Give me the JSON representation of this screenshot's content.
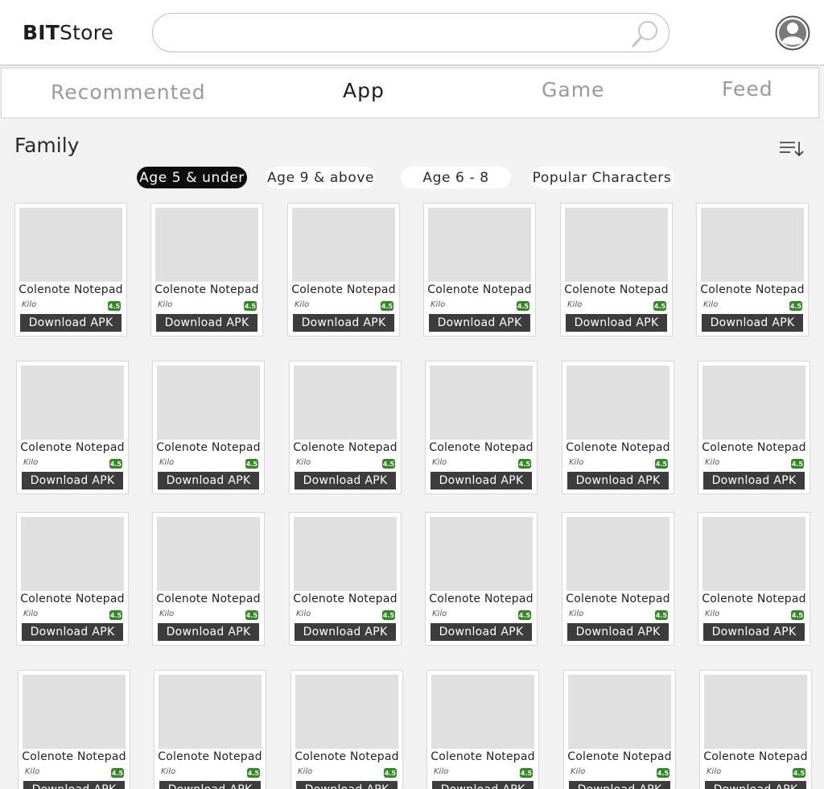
{
  "header": {
    "logo_bold": "BIT",
    "logo_rest": "Store",
    "search_value": "",
    "search_icon": "search-icon",
    "avatar_icon": "user-avatar-icon"
  },
  "tabs": [
    {
      "label": "Recommented",
      "active": false
    },
    {
      "label": "App",
      "active": true
    },
    {
      "label": "Game",
      "active": false
    },
    {
      "label": "Feed",
      "active": false
    }
  ],
  "section": {
    "title": "Family",
    "sort_icon": "sort-descending-icon"
  },
  "filters": [
    {
      "label": "Age 5 & under",
      "active": true
    },
    {
      "label": "Age 9 & above",
      "active": false
    },
    {
      "label": "Age 6 - 8",
      "active": false
    },
    {
      "label": "Popular Characters",
      "active": false
    }
  ],
  "colors": {
    "rating_badge": "#2f8a1f",
    "download_button": "#3d3d3d",
    "active_filter": "#0d0d0d"
  },
  "app_card": {
    "name": "Colenote Notepad",
    "developer": "Kilo",
    "rating": "4.5",
    "button_label": "Download APK"
  },
  "grid": {
    "rows": 4,
    "columns": 6
  }
}
